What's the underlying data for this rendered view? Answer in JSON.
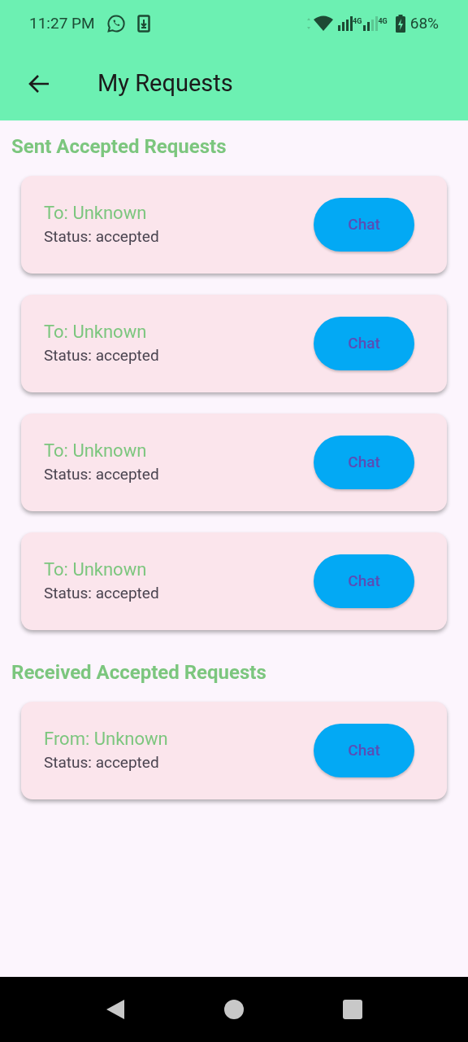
{
  "status_bar": {
    "time": "11:27 PM",
    "network_labels": [
      "4G",
      "4G"
    ],
    "battery": "68%"
  },
  "app_bar": {
    "title": "My Requests"
  },
  "sections": [
    {
      "title": "Sent Accepted Requests",
      "requests": [
        {
          "party": "To: Unknown",
          "status": "Status: accepted",
          "button": "Chat"
        },
        {
          "party": "To: Unknown",
          "status": "Status: accepted",
          "button": "Chat"
        },
        {
          "party": "To: Unknown",
          "status": "Status: accepted",
          "button": "Chat"
        },
        {
          "party": "To: Unknown",
          "status": "Status: accepted",
          "button": "Chat"
        }
      ]
    },
    {
      "title": "Received Accepted Requests",
      "requests": [
        {
          "party": "From: Unknown",
          "status": "Status: accepted",
          "button": "Chat"
        }
      ]
    }
  ]
}
